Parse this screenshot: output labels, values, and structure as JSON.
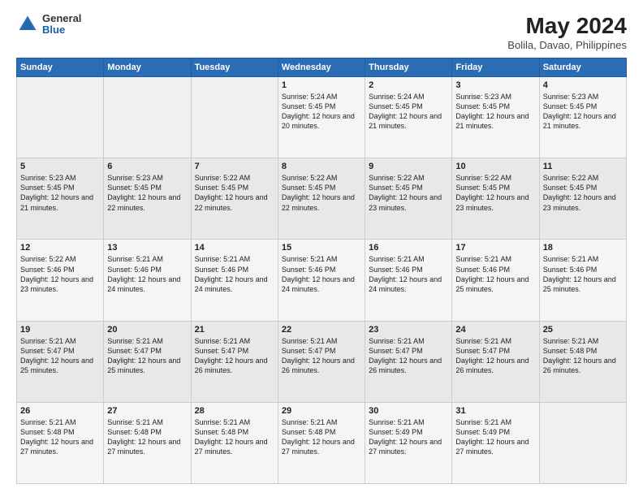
{
  "header": {
    "logo_general": "General",
    "logo_blue": "Blue",
    "month_year": "May 2024",
    "location": "Bolila, Davao, Philippines"
  },
  "weekdays": [
    "Sunday",
    "Monday",
    "Tuesday",
    "Wednesday",
    "Thursday",
    "Friday",
    "Saturday"
  ],
  "weeks": [
    [
      {
        "day": "",
        "empty": true
      },
      {
        "day": "",
        "empty": true
      },
      {
        "day": "",
        "empty": true
      },
      {
        "day": "1",
        "sunrise": "5:24 AM",
        "sunset": "5:45 PM",
        "daylight": "12 hours and 20 minutes."
      },
      {
        "day": "2",
        "sunrise": "5:24 AM",
        "sunset": "5:45 PM",
        "daylight": "12 hours and 21 minutes."
      },
      {
        "day": "3",
        "sunrise": "5:23 AM",
        "sunset": "5:45 PM",
        "daylight": "12 hours and 21 minutes."
      },
      {
        "day": "4",
        "sunrise": "5:23 AM",
        "sunset": "5:45 PM",
        "daylight": "12 hours and 21 minutes."
      }
    ],
    [
      {
        "day": "5",
        "sunrise": "5:23 AM",
        "sunset": "5:45 PM",
        "daylight": "12 hours and 21 minutes."
      },
      {
        "day": "6",
        "sunrise": "5:23 AM",
        "sunset": "5:45 PM",
        "daylight": "12 hours and 22 minutes."
      },
      {
        "day": "7",
        "sunrise": "5:22 AM",
        "sunset": "5:45 PM",
        "daylight": "12 hours and 22 minutes."
      },
      {
        "day": "8",
        "sunrise": "5:22 AM",
        "sunset": "5:45 PM",
        "daylight": "12 hours and 22 minutes."
      },
      {
        "day": "9",
        "sunrise": "5:22 AM",
        "sunset": "5:45 PM",
        "daylight": "12 hours and 23 minutes."
      },
      {
        "day": "10",
        "sunrise": "5:22 AM",
        "sunset": "5:45 PM",
        "daylight": "12 hours and 23 minutes."
      },
      {
        "day": "11",
        "sunrise": "5:22 AM",
        "sunset": "5:45 PM",
        "daylight": "12 hours and 23 minutes."
      }
    ],
    [
      {
        "day": "12",
        "sunrise": "5:22 AM",
        "sunset": "5:46 PM",
        "daylight": "12 hours and 23 minutes."
      },
      {
        "day": "13",
        "sunrise": "5:21 AM",
        "sunset": "5:46 PM",
        "daylight": "12 hours and 24 minutes."
      },
      {
        "day": "14",
        "sunrise": "5:21 AM",
        "sunset": "5:46 PM",
        "daylight": "12 hours and 24 minutes."
      },
      {
        "day": "15",
        "sunrise": "5:21 AM",
        "sunset": "5:46 PM",
        "daylight": "12 hours and 24 minutes."
      },
      {
        "day": "16",
        "sunrise": "5:21 AM",
        "sunset": "5:46 PM",
        "daylight": "12 hours and 24 minutes."
      },
      {
        "day": "17",
        "sunrise": "5:21 AM",
        "sunset": "5:46 PM",
        "daylight": "12 hours and 25 minutes."
      },
      {
        "day": "18",
        "sunrise": "5:21 AM",
        "sunset": "5:46 PM",
        "daylight": "12 hours and 25 minutes."
      }
    ],
    [
      {
        "day": "19",
        "sunrise": "5:21 AM",
        "sunset": "5:47 PM",
        "daylight": "12 hours and 25 minutes."
      },
      {
        "day": "20",
        "sunrise": "5:21 AM",
        "sunset": "5:47 PM",
        "daylight": "12 hours and 25 minutes."
      },
      {
        "day": "21",
        "sunrise": "5:21 AM",
        "sunset": "5:47 PM",
        "daylight": "12 hours and 26 minutes."
      },
      {
        "day": "22",
        "sunrise": "5:21 AM",
        "sunset": "5:47 PM",
        "daylight": "12 hours and 26 minutes."
      },
      {
        "day": "23",
        "sunrise": "5:21 AM",
        "sunset": "5:47 PM",
        "daylight": "12 hours and 26 minutes."
      },
      {
        "day": "24",
        "sunrise": "5:21 AM",
        "sunset": "5:47 PM",
        "daylight": "12 hours and 26 minutes."
      },
      {
        "day": "25",
        "sunrise": "5:21 AM",
        "sunset": "5:48 PM",
        "daylight": "12 hours and 26 minutes."
      }
    ],
    [
      {
        "day": "26",
        "sunrise": "5:21 AM",
        "sunset": "5:48 PM",
        "daylight": "12 hours and 27 minutes."
      },
      {
        "day": "27",
        "sunrise": "5:21 AM",
        "sunset": "5:48 PM",
        "daylight": "12 hours and 27 minutes."
      },
      {
        "day": "28",
        "sunrise": "5:21 AM",
        "sunset": "5:48 PM",
        "daylight": "12 hours and 27 minutes."
      },
      {
        "day": "29",
        "sunrise": "5:21 AM",
        "sunset": "5:48 PM",
        "daylight": "12 hours and 27 minutes."
      },
      {
        "day": "30",
        "sunrise": "5:21 AM",
        "sunset": "5:49 PM",
        "daylight": "12 hours and 27 minutes."
      },
      {
        "day": "31",
        "sunrise": "5:21 AM",
        "sunset": "5:49 PM",
        "daylight": "12 hours and 27 minutes."
      },
      {
        "day": "",
        "empty": true
      }
    ]
  ],
  "labels": {
    "sunrise_prefix": "Sunrise: ",
    "sunset_prefix": "Sunset: ",
    "daylight_prefix": "Daylight: "
  }
}
